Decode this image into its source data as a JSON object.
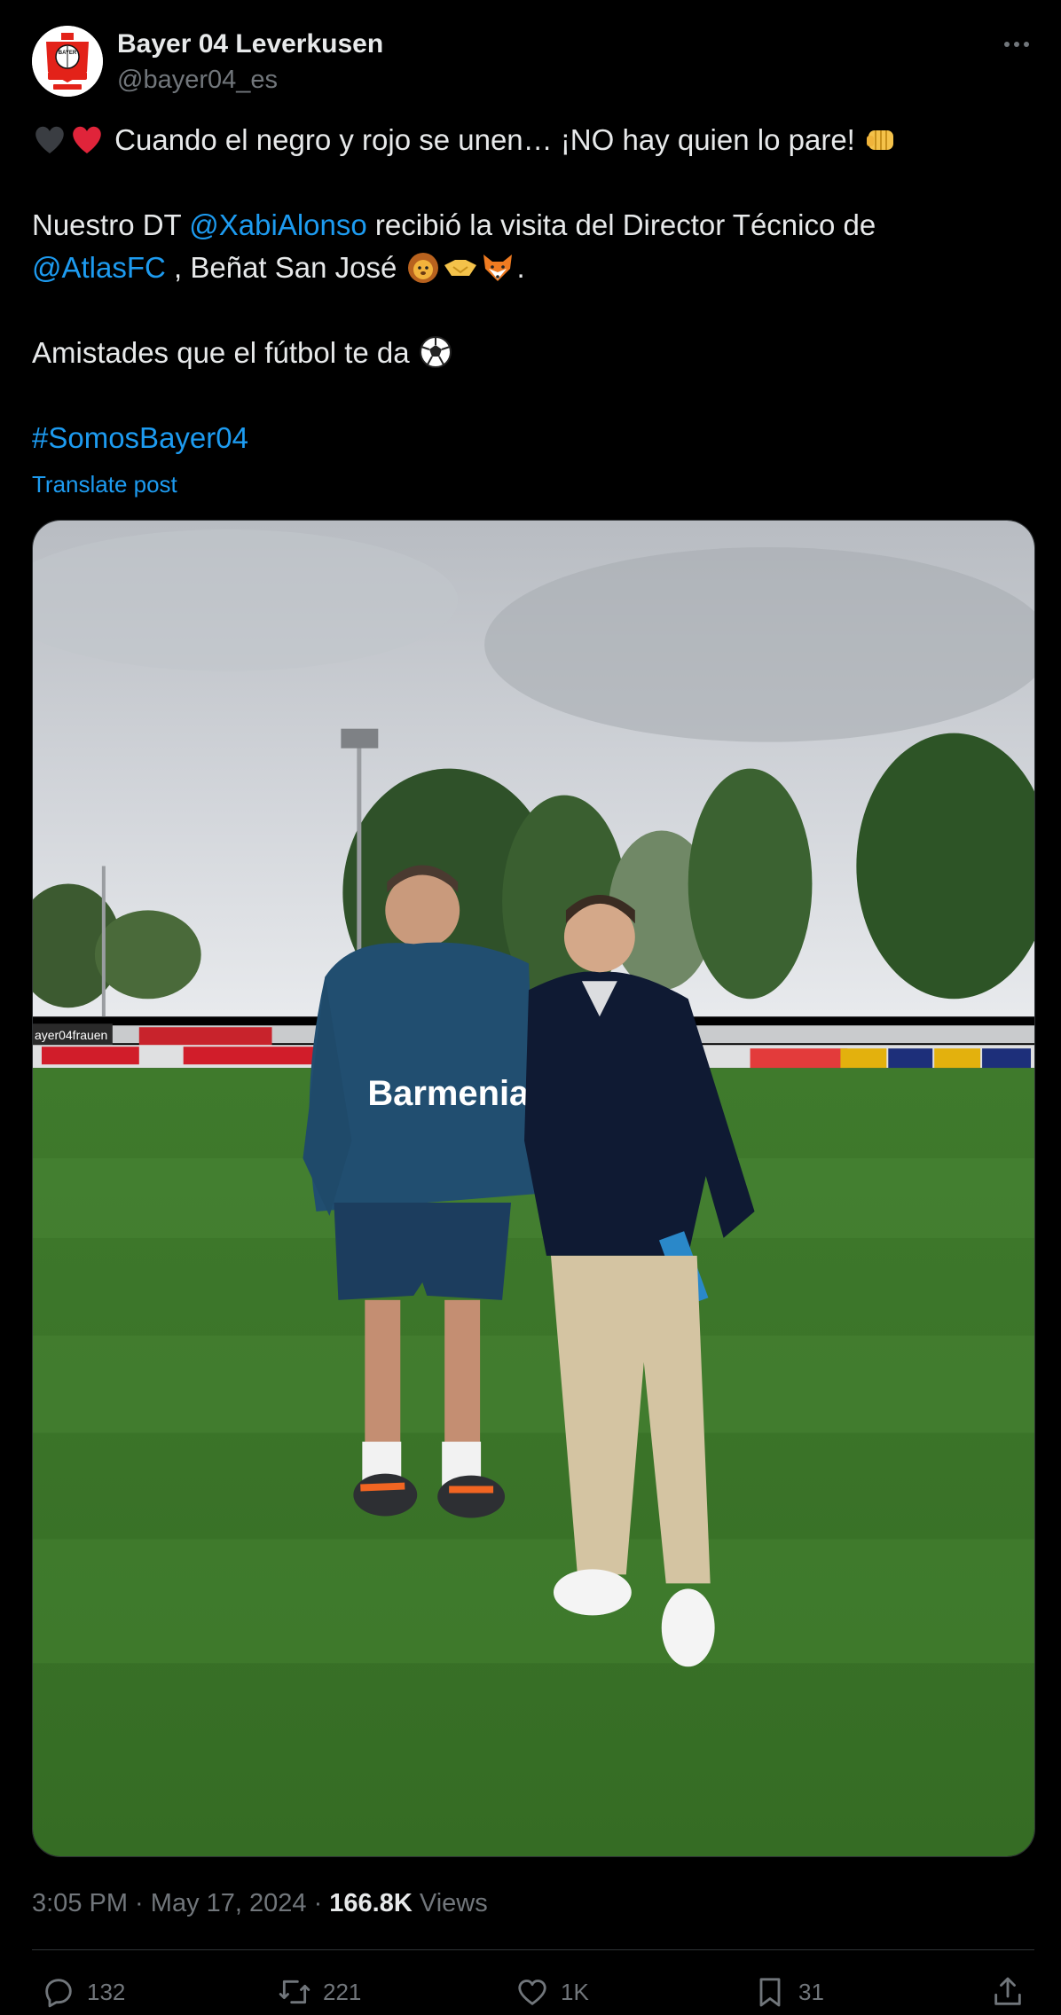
{
  "author": {
    "display_name": "Bayer 04 Leverkusen",
    "handle": "@bayer04_es",
    "avatar_icon": "bayer-04-crest"
  },
  "post": {
    "line1_text": " Cuando el negro y rojo se unen… ¡NO hay quien lo pare! ",
    "line2_prefix": "Nuestro DT ",
    "mention1": "@XabiAlonso",
    "line2_suffix": " recibió la visita del Director Técnico de",
    "mention2": "@AtlasFC",
    "line3_suffix": " , Beñat San José ",
    "line3_end": ".",
    "line4_text": "Amistades que el fútbol te da ",
    "hashtag": "#SomosBayer04",
    "translate_label": "Translate post"
  },
  "meta": {
    "time": "3:05 PM",
    "separator1": " · ",
    "date": "May 17, 2024",
    "separator2": " · ",
    "views_count": "166.8K",
    "views_label": " Views"
  },
  "actions": {
    "replies": "132",
    "reposts": "221",
    "likes": "1K",
    "bookmarks": "31"
  },
  "colors": {
    "background": "#000000",
    "text": "#e7e9ea",
    "secondary": "#71767b",
    "link": "#1d9bf0",
    "divider": "#2f3336"
  }
}
